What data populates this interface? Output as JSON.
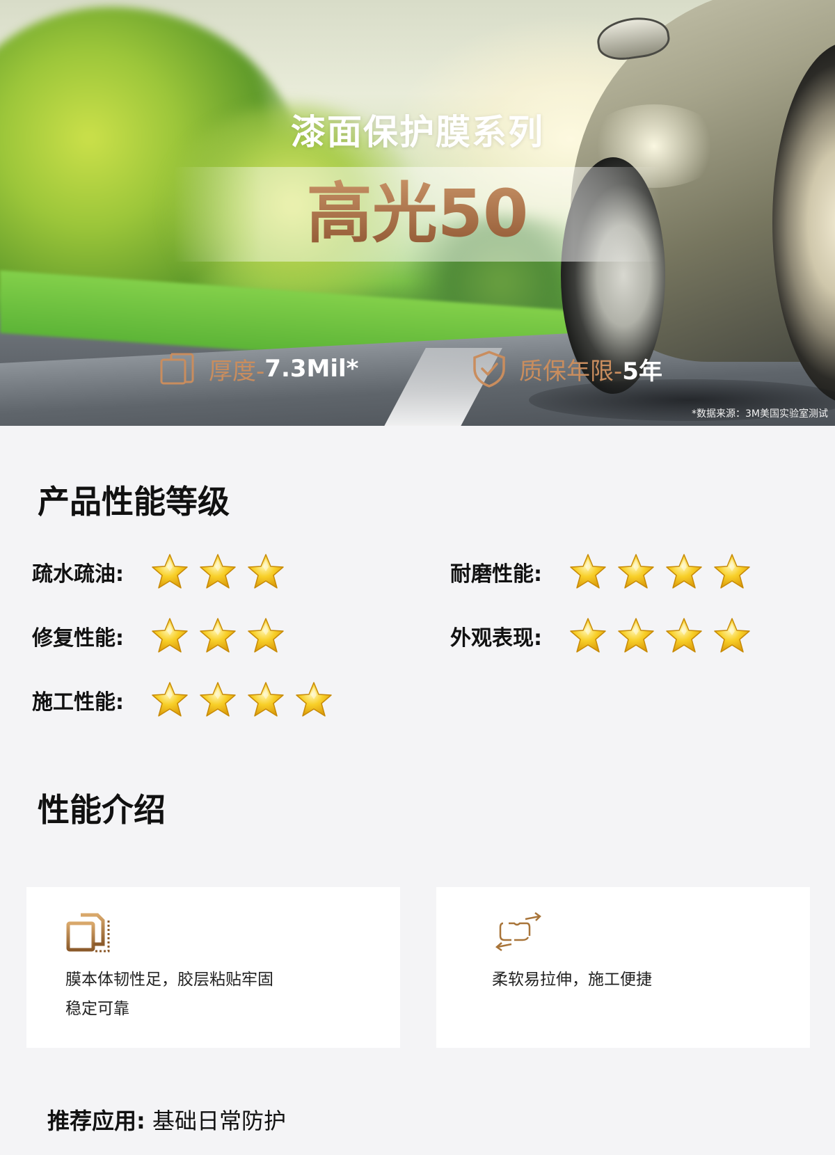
{
  "hero": {
    "series_title": "漆面保护膜系列",
    "product_name": "高光50",
    "specs": [
      {
        "icon": "film-layers-icon",
        "label": "厚度-",
        "value": "7.3Mil*"
      },
      {
        "icon": "shield-check-icon",
        "label": "质保年限-",
        "value": "5年"
      }
    ],
    "source_note": "*数据来源：3M美国实验室测试"
  },
  "ratings": {
    "title": "产品性能等级",
    "items": [
      {
        "label": "疏水疏油:",
        "stars": 3
      },
      {
        "label": "修复性能:",
        "stars": 3
      },
      {
        "label": "施工性能:",
        "stars": 4
      },
      {
        "label": "耐磨性能:",
        "stars": 4
      },
      {
        "label": "外观表现:",
        "stars": 4
      }
    ]
  },
  "intro": {
    "title": "性能介绍",
    "cards": [
      {
        "icon": "film-toughness-icon",
        "line1": "膜本体韧性足，胶层粘贴牢固",
        "line2": "稳定可靠"
      },
      {
        "icon": "stretch-arrows-icon",
        "line1": "柔软易拉伸，施工便捷",
        "line2": ""
      }
    ]
  },
  "recommend": {
    "key": "推荐应用:",
    "value": "基础日常防护"
  },
  "colors": {
    "accent_gold": "#c98d5e",
    "product_bronze": "#a0673f",
    "star_gold": "#f6c21a",
    "page_bg": "#f4f4f6"
  }
}
